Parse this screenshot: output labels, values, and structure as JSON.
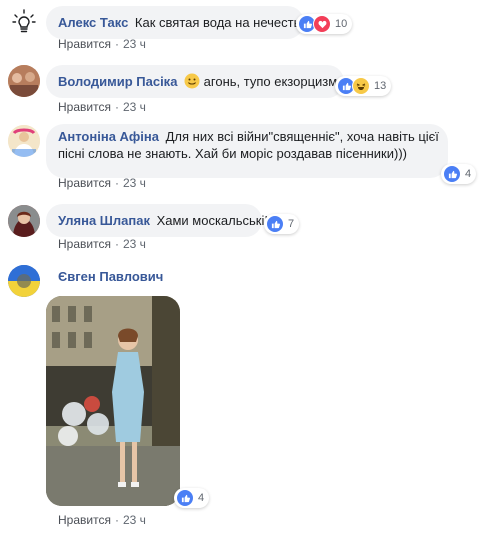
{
  "comments": [
    {
      "author": "Алекс Такс",
      "text": "Как святая вода на нечесть",
      "reaction_count": "10",
      "like_label": "Нравится",
      "time": "23 ч"
    },
    {
      "author": "Володимир Пасіка",
      "text": "агонь, тупо екзорцизм",
      "reaction_count": "13",
      "like_label": "Нравится",
      "time": "23 ч"
    },
    {
      "author": "Антоніна Афіна",
      "text": "Для них всі війни\"священніє\", хоча навіть цієї пісні слова не знають. Хай би моріс роздавав пісенники)))",
      "reaction_count": "4",
      "like_label": "Нравится",
      "time": "23 ч"
    },
    {
      "author": "Уляна Шлапак",
      "text": "Хами москальські!",
      "reaction_count": "7",
      "like_label": "Нравится",
      "time": "23 ч"
    },
    {
      "author": "Євген Павлович",
      "text": "",
      "reaction_count": "4",
      "like_label": "Нравится",
      "time": "23 ч"
    }
  ],
  "colors": {
    "author": "#385898",
    "bubble": "#f2f3f5",
    "like": "#4b7ff5",
    "love": "#f33e58",
    "haha": "#f7c948"
  }
}
